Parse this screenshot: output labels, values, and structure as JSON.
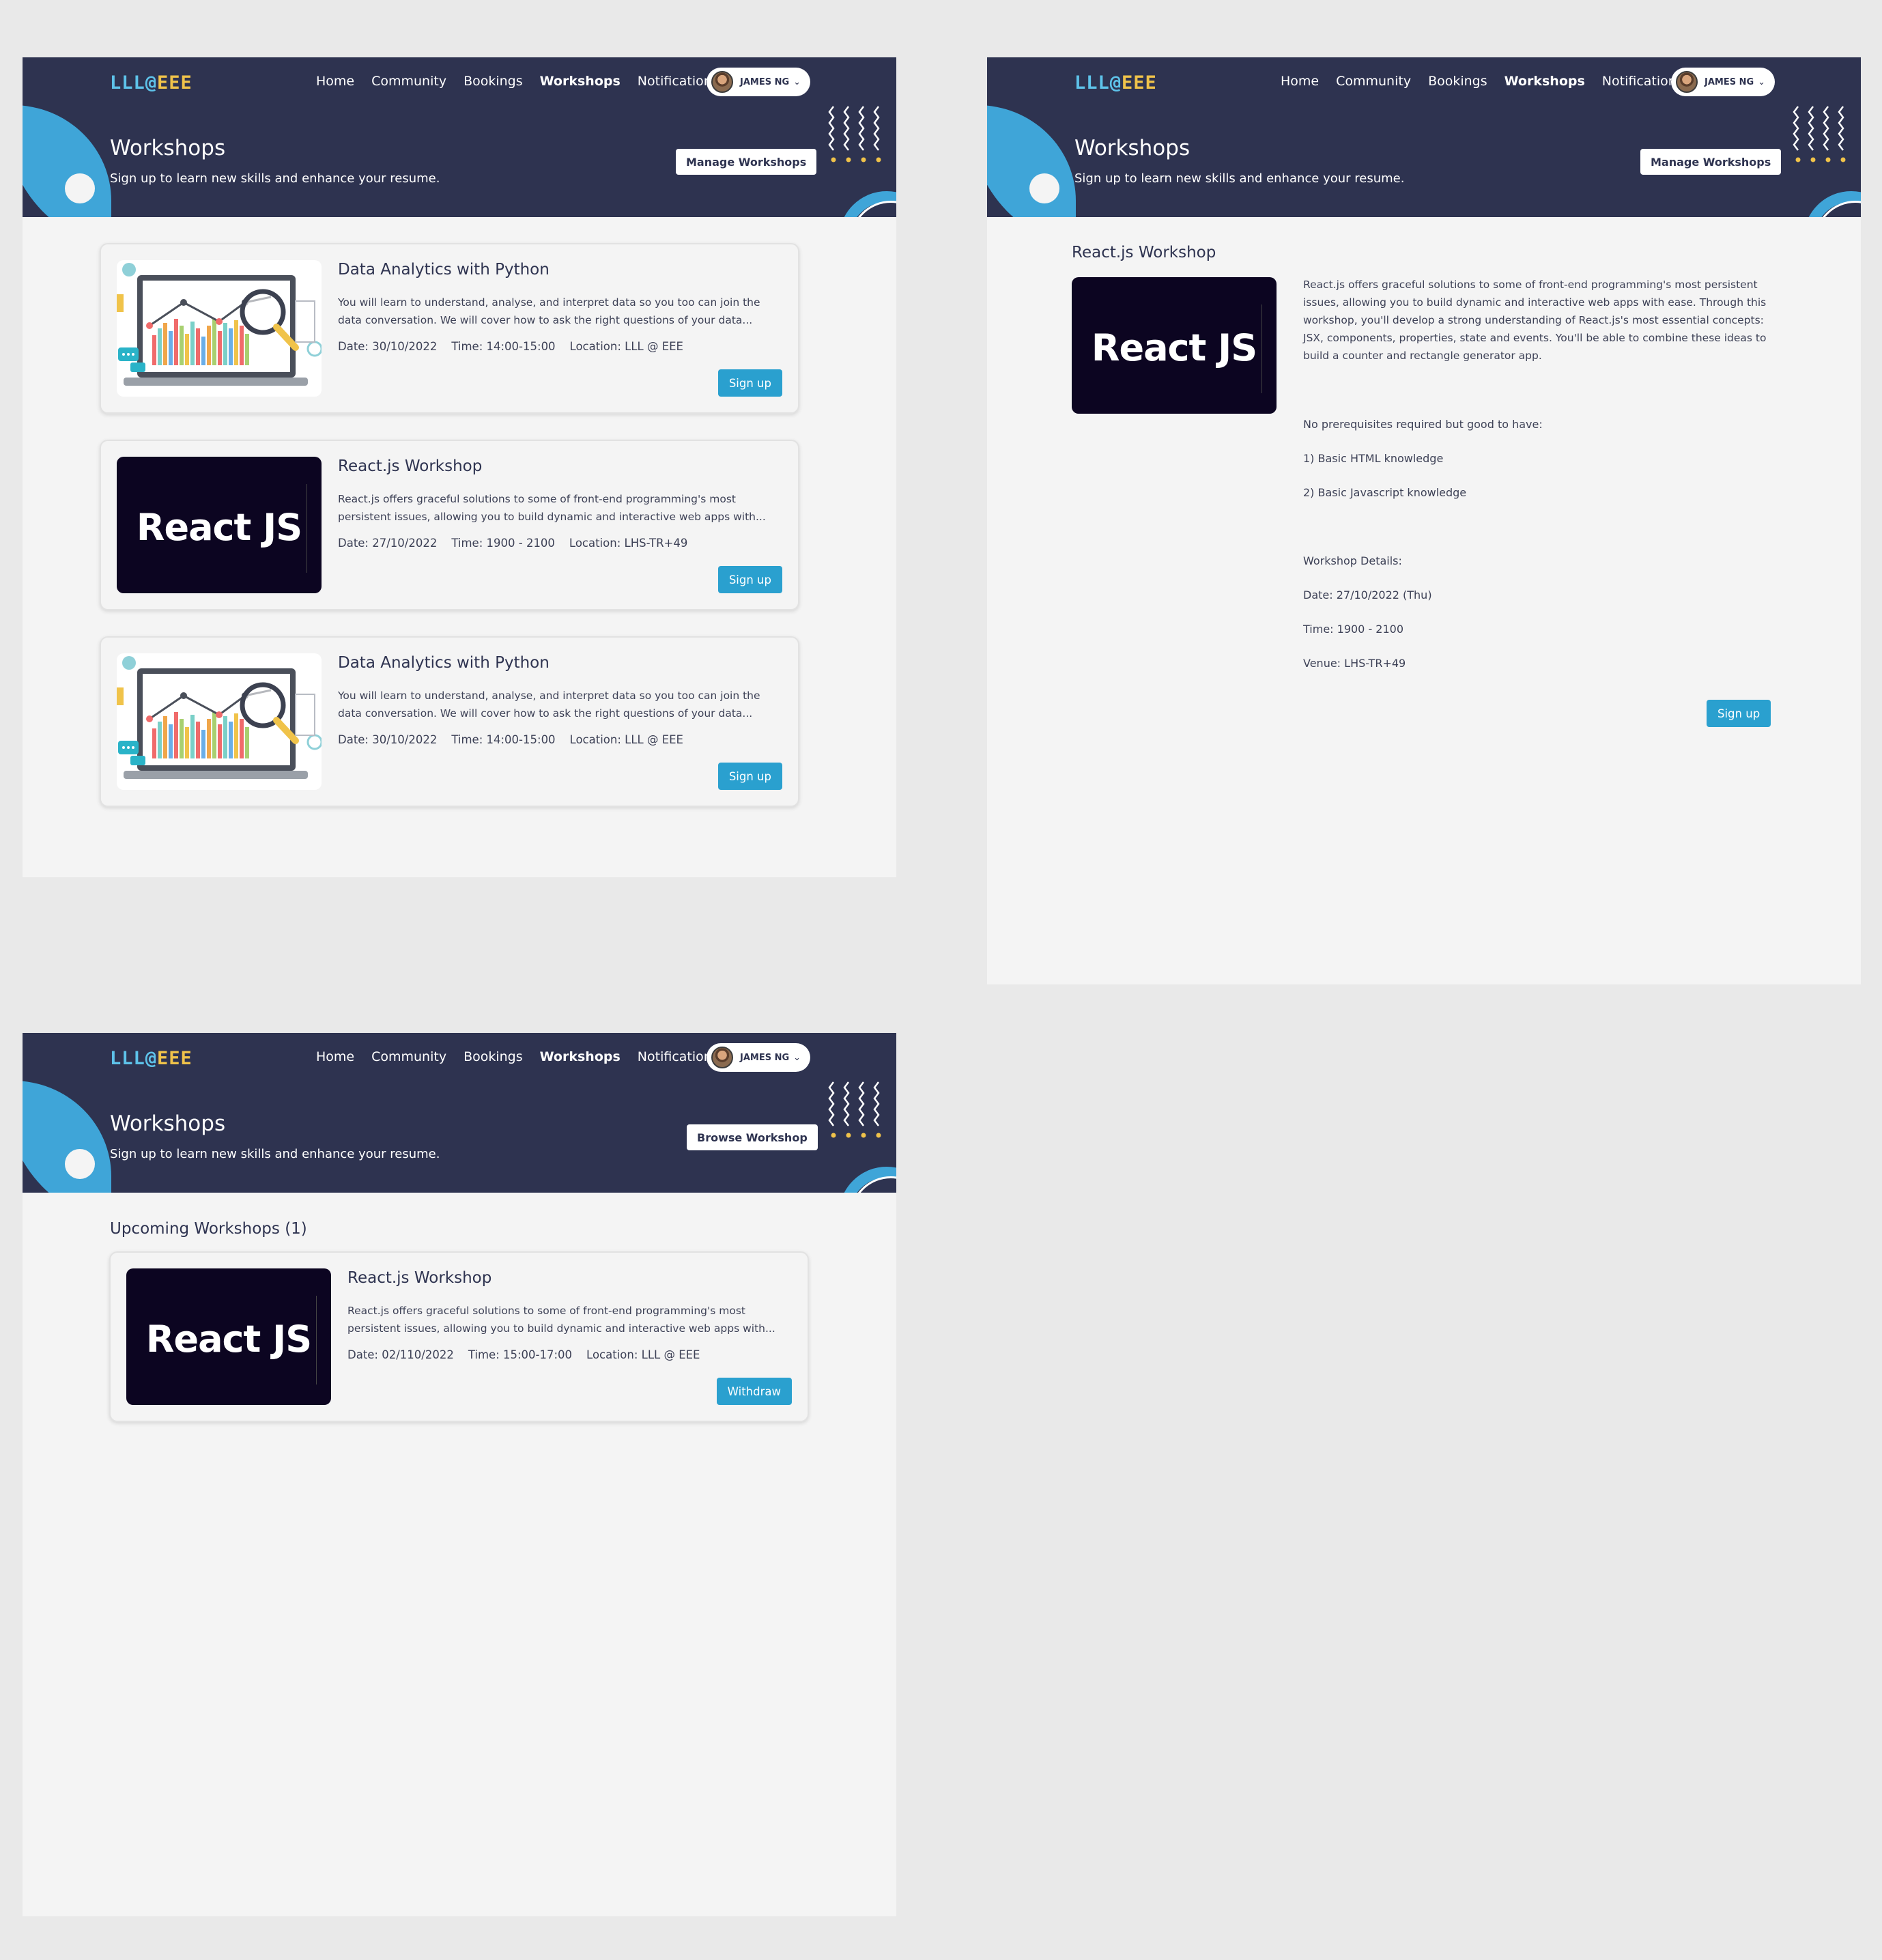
{
  "header": {
    "logo_part1": "LLL@",
    "logo_part2": "EEE",
    "nav": [
      "Home",
      "Community",
      "Bookings",
      "Workshops",
      "Notifications"
    ],
    "active_nav": "Workshops",
    "user_name": "JAMES NG",
    "title": "Workshops",
    "subtitle": "Sign up to learn new skills and enhance your resume."
  },
  "colors": {
    "header_bg": "#2e3350",
    "accent_blue": "#2aa0cf",
    "logo_blue": "#5ec3ea",
    "logo_yellow": "#f0c34a",
    "react_bg": "#0c0521"
  },
  "screen_browse": {
    "action_button": "Manage Workshops",
    "cards": [
      {
        "image": "data-analytics-illustration",
        "title": "Data Analytics with Python",
        "description": "You will learn to understand, analyse, and interpret data so you too can join the data conversation. We will cover how to ask the right questions of your data...",
        "meta": "Date: 30/10/2022    Time: 14:00-15:00    Location: LLL @ EEE",
        "button": "Sign up"
      },
      {
        "image": "react-js-logo",
        "image_text": "React JS",
        "title": "React.js Workshop",
        "description": "React.js offers graceful solutions to some of front-end programming's most persistent issues, allowing you to build dynamic and interactive web apps with...",
        "meta": "Date: 27/10/2022    Time: 1900 - 2100    Location: LHS-TR+49",
        "button": "Sign up"
      },
      {
        "image": "data-analytics-illustration",
        "title": "Data Analytics with Python",
        "description": "You will learn to understand, analyse, and interpret data so you too can join the data conversation. We will cover how to ask the right questions of your data...",
        "meta": "Date: 30/10/2022    Time: 14:00-15:00    Location: LLL @ EEE",
        "button": "Sign up"
      }
    ]
  },
  "screen_detail": {
    "action_button": "Manage Workshops",
    "title": "React.js Workshop",
    "image_text": "React JS",
    "description": "React.js offers graceful solutions to some of front-end programming's most persistent issues, allowing you to build dynamic and interactive web apps with ease. Through this workshop, you'll develop a strong understanding of React.js's most essential concepts: JSX, components, properties, state and events. You'll be able to combine these ideas to build a counter and rectangle generator app.",
    "prereq_heading": "No prerequisites required but good to have:",
    "prereq_1": "1) Basic HTML knowledge",
    "prereq_2": "2) Basic Javascript knowledge",
    "details_heading": "Workshop Details:",
    "date": "Date: 27/10/2022 (Thu)",
    "time": "Time: 1900 - 2100",
    "venue": "Venue: LHS-TR+49",
    "button": "Sign up"
  },
  "screen_manage": {
    "action_button": "Browse Workshop",
    "section_title": "Upcoming Workshops (1)",
    "card": {
      "image_text": "React JS",
      "title": "React.js Workshop",
      "description": "React.js offers graceful solutions to some of front-end programming's most persistent issues, allowing you to build dynamic and interactive web apps with...",
      "meta": "Date: 02/110/2022    Time: 15:00-17:00    Location: LLL @ EEE",
      "button": "Withdraw"
    }
  }
}
